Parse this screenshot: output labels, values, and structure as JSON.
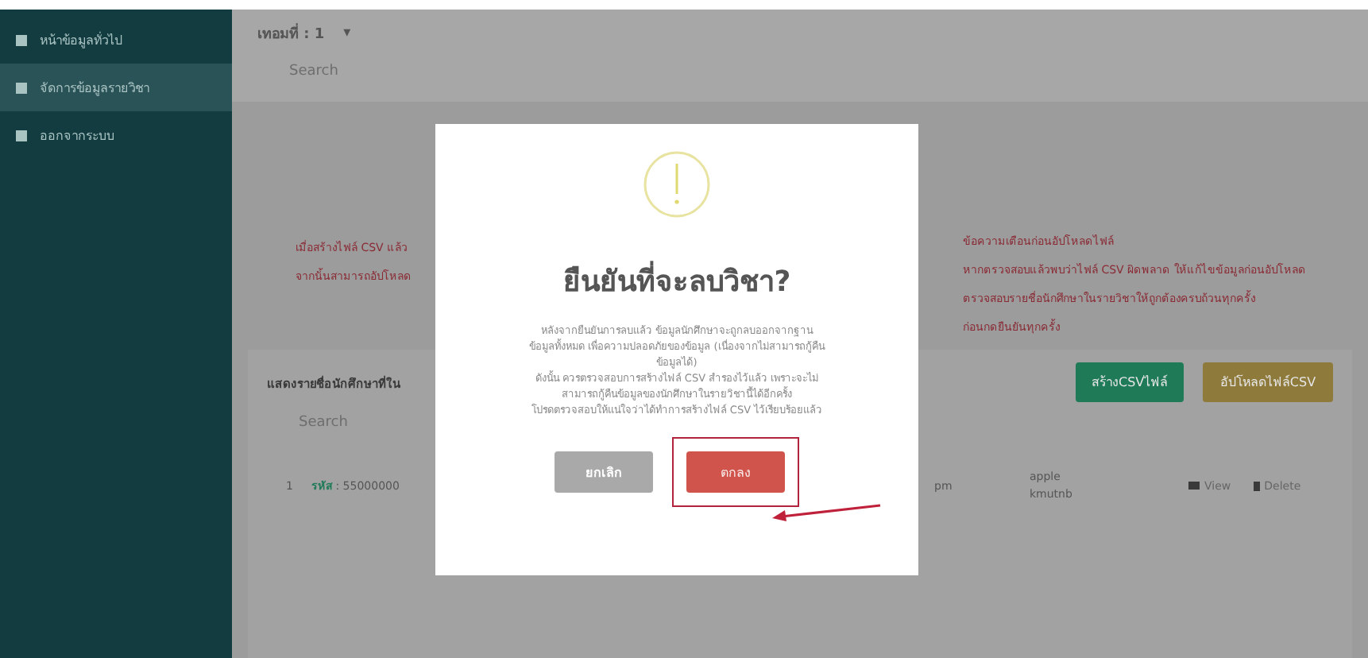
{
  "sidebar": {
    "items": [
      {
        "label": "หน้าข้อมูลทั่วไป",
        "selected": false
      },
      {
        "label": "จัดการข้อมูลรายวิชา",
        "selected": true
      },
      {
        "label": "ออกจากระบบ",
        "selected": false
      }
    ]
  },
  "top_bar": {
    "term_label": "เทอมที่ : 1",
    "caret": "▾",
    "search": {
      "placeholder": "Search"
    }
  },
  "warning": {
    "left_lines": [
      "เมื่อสร้างไฟล์ CSV แล้ว",
      "จากนั้นสามารถอัปโหลด"
    ],
    "right_lines": [
      "ข้อความเตือนก่อนอัปโหลดไฟล์",
      "หากตรวจสอบแล้วพบว่าไฟล์ CSV ผิดพลาด ให้แก้ไขข้อมูลก่อนอัปโหลด",
      "ตรวจสอบรายชื่อนักศึกษาในรายวิชาให้ถูกต้องครบถ้วนทุกครั้ง",
      "ก่อนกดยืนยันทุกครั้ง"
    ]
  },
  "students": {
    "title": "แสดงรายชื่อนักศึกษาที่ใน",
    "buttons": [
      {
        "label": "สร้างCSVไฟล์",
        "kind": "create"
      },
      {
        "label": "อัปโหลดไฟล์CSV",
        "kind": "upload"
      }
    ],
    "search": {
      "placeholder": "Search"
    },
    "rows": [
      {
        "index": "1",
        "code_label": "รหัส",
        "code": ": 55000000",
        "time": "pm",
        "name_lines": [
          "apple",
          "kmutnb"
        ],
        "view": "View",
        "delete": "Delete"
      }
    ]
  },
  "dialog": {
    "title": "ยืนยันที่จะลบวิชา?",
    "body_lines": [
      "หลังจากยืนยันการลบแล้ว ข้อมูลนักศึกษาจะถูกลบออกจากฐาน",
      "ข้อมูลทั้งหมด เพื่อความปลอดภัยของข้อมูล (เนื่องจากไม่สามารถกู้คืน",
      "ข้อมูลได้)",
      "ดังนั้น ควรตรวจสอบการสร้างไฟล์ CSV สำรองไว้แล้ว เพราะจะไม่",
      "สามารถกู้คืนข้อมูลของนักศึกษาในรายวิชานี้ได้อีกครั้ง",
      "โปรดตรวจสอบให้แน่ใจว่าได้ทำการสร้างไฟล์ CSV ไว้เรียบร้อยแล้ว"
    ],
    "buttons": [
      {
        "label": "ยกเลิก",
        "kind": "cancel"
      },
      {
        "label": "ตกลง",
        "kind": "confirm",
        "highlighted": true
      }
    ]
  }
}
